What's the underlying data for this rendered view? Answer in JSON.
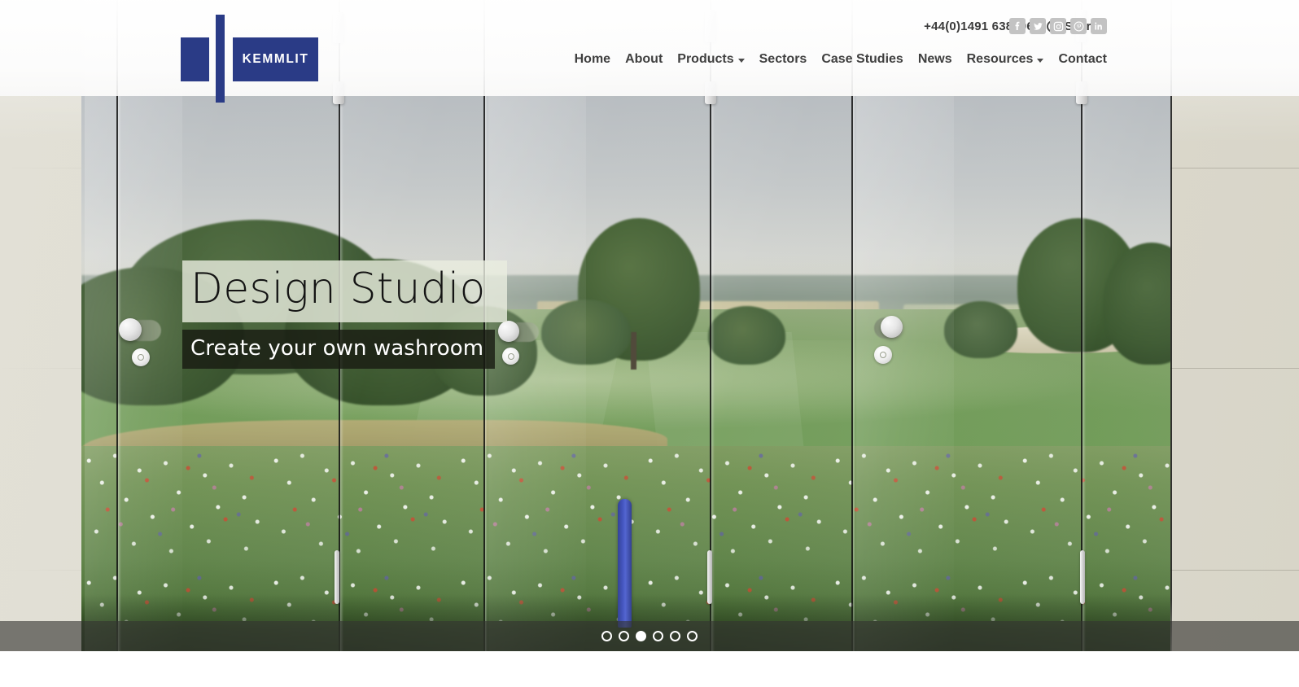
{
  "site": {
    "brand": "KEMMLIT",
    "logo_color": "#2a3b86"
  },
  "header": {
    "phone": "+44(0)1491 638606",
    "search_label": "Search",
    "search_icon": "search-icon",
    "socials": [
      {
        "name": "facebook-icon",
        "label": "Facebook"
      },
      {
        "name": "twitter-icon",
        "label": "Twitter"
      },
      {
        "name": "instagram-icon",
        "label": "Instagram"
      },
      {
        "name": "pinterest-icon",
        "label": "Pinterest"
      },
      {
        "name": "linkedin-icon",
        "label": "LinkedIn"
      }
    ],
    "nav": [
      {
        "label": "Home",
        "has_dropdown": false
      },
      {
        "label": "About",
        "has_dropdown": false
      },
      {
        "label": "Products",
        "has_dropdown": true
      },
      {
        "label": "Sectors",
        "has_dropdown": false
      },
      {
        "label": "Case Studies",
        "has_dropdown": false
      },
      {
        "label": "News",
        "has_dropdown": false
      },
      {
        "label": "Resources",
        "has_dropdown": true
      },
      {
        "label": "Contact",
        "has_dropdown": false
      }
    ]
  },
  "hero": {
    "title": "Design Studio",
    "subtitle": "Create your own washroom",
    "title_bg": "rgba(234,238,224,0.80)",
    "subtitle_bg": "rgba(24,26,18,0.80)",
    "image_description": "Golf course landscape with wildflower meadow printed across glass washroom cubicle partitions"
  },
  "carousel": {
    "total_slides": 6,
    "active_slide": 3,
    "dots": [
      1,
      2,
      3,
      4,
      5,
      6
    ]
  }
}
